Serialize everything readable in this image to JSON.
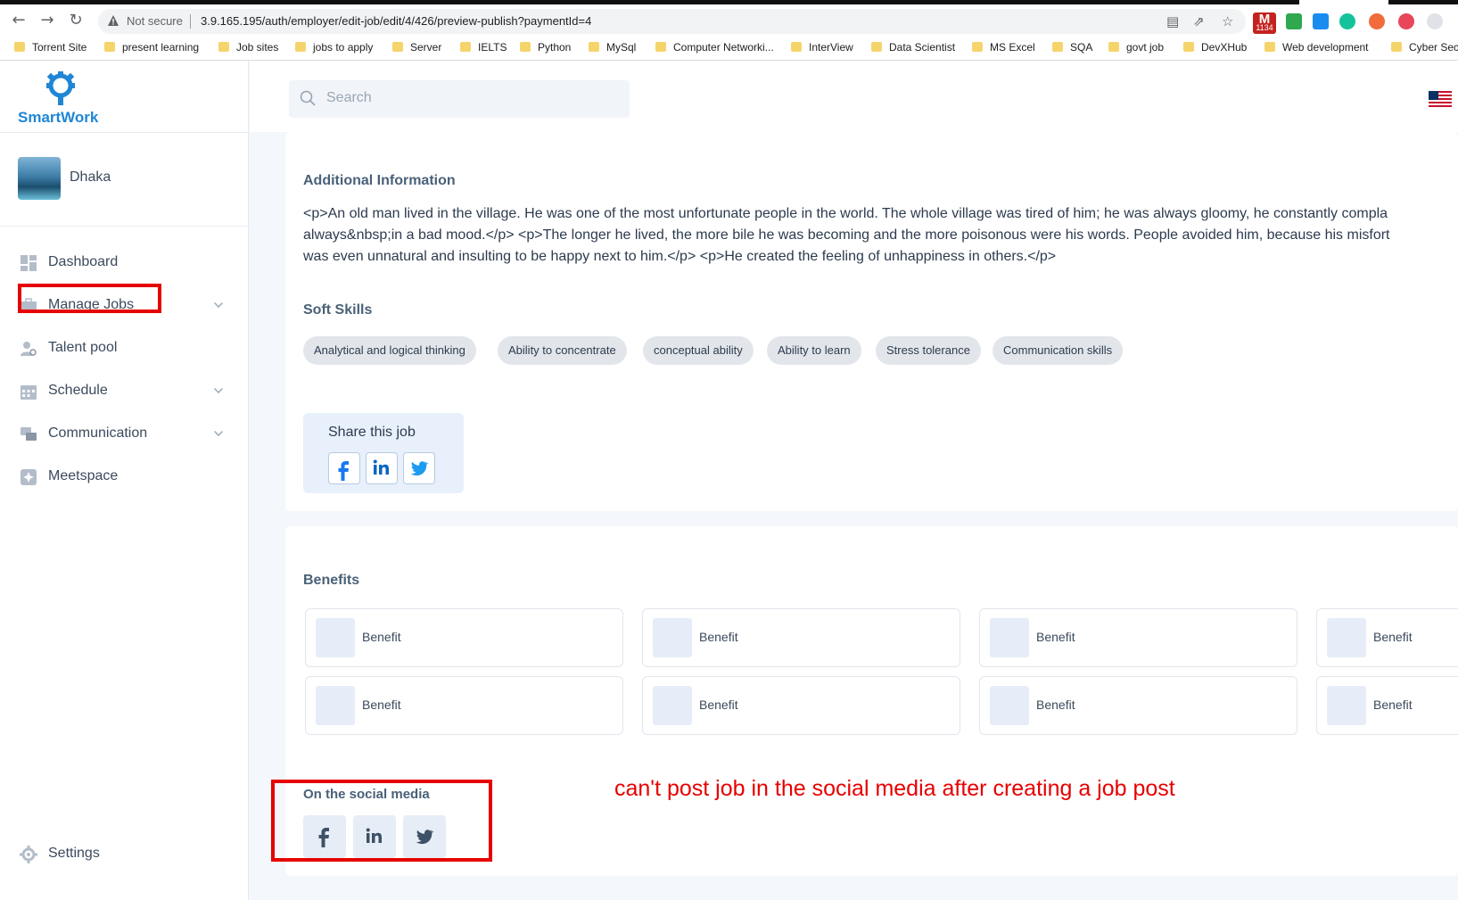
{
  "browser": {
    "security_label": "Not secure",
    "url": "3.9.165.195/auth/employer/edit-job/edit/4/426/preview-publish?paymentId=4",
    "mail_badge_count": "1134",
    "bookmarks": [
      "Torrent Site",
      "present learning",
      "Job sites",
      "jobs to apply",
      "Server",
      "IELTS",
      "Python",
      "MySql",
      "Computer Networki...",
      "InterView",
      "Data Scientist",
      "MS Excel",
      "SQA",
      "govt job",
      "DevXHub",
      "Web development",
      "Cyber Secu"
    ]
  },
  "sidebar": {
    "brand": "SmartWork",
    "user_name": "Dhaka",
    "items": [
      {
        "label": "Dashboard",
        "icon": "dashboard-icon"
      },
      {
        "label": "Manage Jobs",
        "icon": "briefcase-icon"
      },
      {
        "label": "Talent pool",
        "icon": "user-search-icon"
      },
      {
        "label": "Schedule",
        "icon": "calendar-icon"
      },
      {
        "label": "Communication",
        "icon": "chat-icon"
      },
      {
        "label": "Meetspace",
        "icon": "meetspace-icon"
      }
    ],
    "settings_label": "Settings"
  },
  "header": {
    "search_placeholder": "Search"
  },
  "additional_info": {
    "title": "Additional Information",
    "lines": [
      "<p>An old man lived in the village. He was one of the most unfortunate people in the world. The whole village was tired of him; he was always gloomy, he constantly compla",
      "always&nbsp;in a bad mood.</p> <p>The longer he lived, the more bile he was becoming and the more poisonous were his words. People avoided him, because his misfort",
      "was even unnatural and insulting to be happy next to him.</p> <p>He created the feeling of unhappiness in others.</p>"
    ]
  },
  "soft_skills": {
    "title": "Soft Skills",
    "chips": [
      "Analytical and logical thinking",
      "Ability to concentrate",
      "conceptual ability",
      "Ability to learn",
      "Stress tolerance",
      "Communication skills"
    ]
  },
  "share": {
    "title": "Share this job"
  },
  "benefits": {
    "title": "Benefits",
    "items": [
      "Benefit",
      "Benefit",
      "Benefit",
      "Benefit",
      "Benefit",
      "Benefit",
      "Benefit",
      "Benefit"
    ]
  },
  "social": {
    "title": "On the social media"
  },
  "annotation": {
    "note": "can't post job in the social media after creating a job post",
    "color": "#e60000"
  },
  "colors": {
    "brand": "#1f86d6",
    "facebook": "#1877f2",
    "linkedin": "#0a66c2",
    "twitter": "#1d9bf0"
  }
}
